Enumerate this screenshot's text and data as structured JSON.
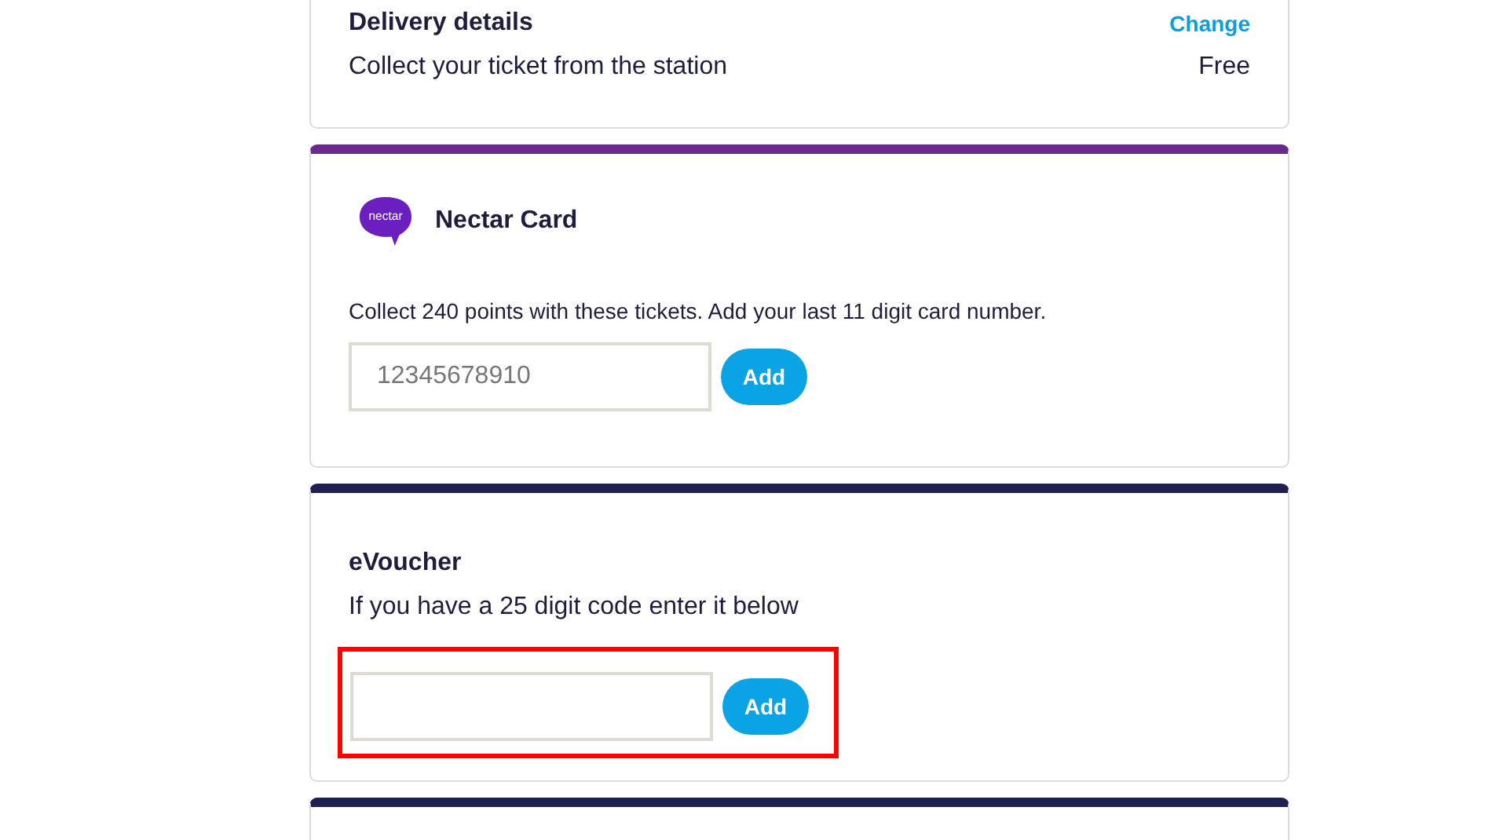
{
  "delivery": {
    "title": "Delivery details",
    "change_link": "Change",
    "method": "Collect your ticket from the station",
    "price": "Free"
  },
  "nectar": {
    "logo_text": "nectar",
    "title": "Nectar Card",
    "description": "Collect 240 points with these tickets. Add your last 11 digit card number.",
    "input": {
      "placeholder": "12345678910"
    },
    "button": "Add"
  },
  "evoucher": {
    "title": "eVoucher",
    "description": "If you have a 25 digit code enter it below",
    "button": "Add",
    "highlighted": true
  },
  "next_card": {
    "kind": "card"
  }
}
